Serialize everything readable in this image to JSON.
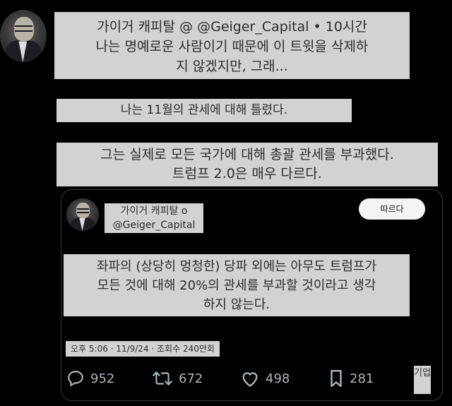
{
  "header": {
    "author_line": "가이거 캐피탈 @ @Geiger_Capital • 10시간",
    "text_line2": "나는 명예로운 사람이기 때문에 이 트윗을 삭제하",
    "text_line3": "지 않겠지만, 그래..."
  },
  "tweet_lines": {
    "line1": "나는 11월의 관세에 대해 틀렸다.",
    "line2": "그는 실제로 모든 국가에 대해 총괄 관세를 부과했다.",
    "line3": "트럼프 2.0은 매우 다르다."
  },
  "quoted": {
    "display_name": "가이거 캐피탈 o",
    "handle": "@Geiger_Capital",
    "follow_label": "따르다",
    "body_line1": "좌파의 (상당히 멍청한) 당파 외에는 아무도 트럼프가",
    "body_line2": "모든 것에 대해 20%의 관세를 부과할 것이라고 생각",
    "body_line3": "하지 않는다.",
    "meta": "오후 5:06 · 11/9/24 · 조회수 240만회"
  },
  "actions": {
    "replies": "952",
    "retweets": "672",
    "likes": "498",
    "bookmarks": "281",
    "side_label": "기업"
  },
  "colors": {
    "background": "#000000",
    "overlay": "#d2d2d2",
    "icon_gray": "#aeb4b9"
  }
}
